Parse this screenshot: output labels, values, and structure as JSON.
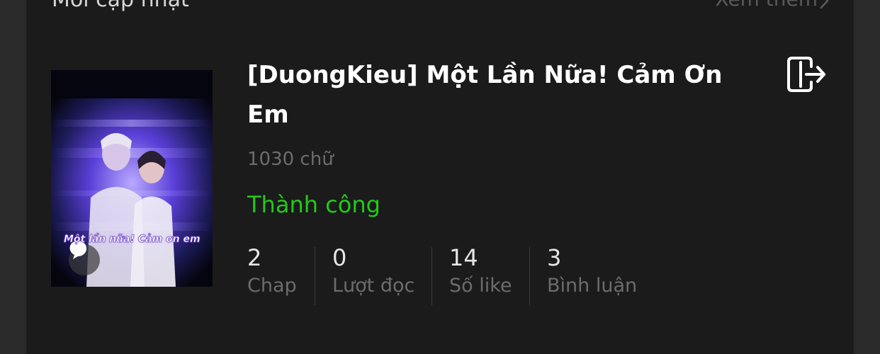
{
  "section": {
    "title": "Mới cập nhật",
    "see_more": "Xem thêm"
  },
  "story": {
    "title": "[DuongKieu] Một Lần Nữa! Cảm Ơn Em",
    "word_count": "1030 chữ",
    "status": "Thành công",
    "cover_caption": "Một lần nữa! Cảm ơn em",
    "status_color": "#23c91a"
  },
  "stats": [
    {
      "value": "2",
      "label": "Chap"
    },
    {
      "value": "0",
      "label": "Lượt đọc"
    },
    {
      "value": "14",
      "label": "Số like"
    },
    {
      "value": "3",
      "label": "Bình luận"
    }
  ],
  "icons": {
    "export": "export-icon",
    "chevron": "chevron-right-icon",
    "chat": "chat-bubble-icon"
  }
}
